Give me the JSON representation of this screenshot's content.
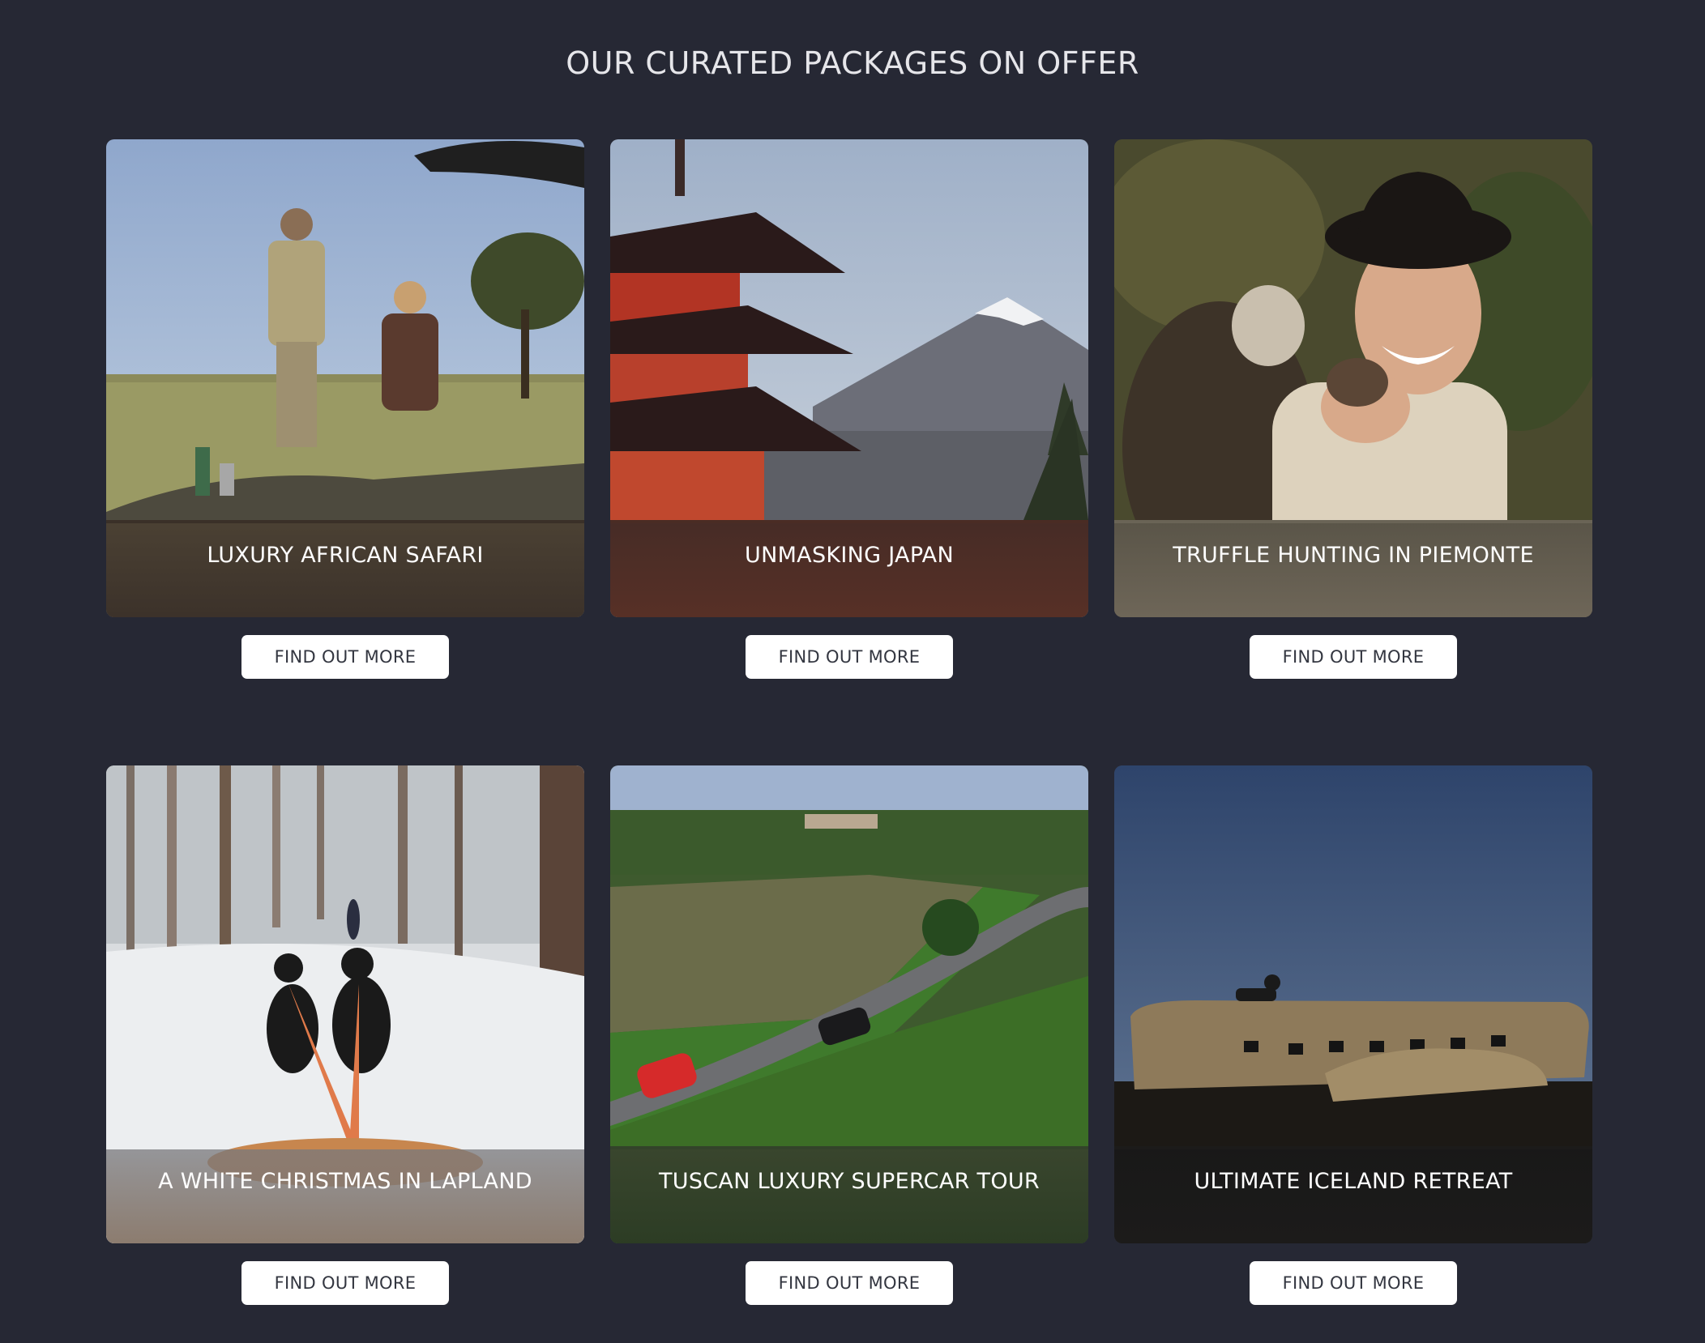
{
  "section": {
    "title": "OUR CURATED PACKAGES ON OFFER"
  },
  "packages": [
    {
      "title": "LUXURY AFRICAN SAFARI",
      "button_label": "FIND OUT MORE"
    },
    {
      "title": "UNMASKING JAPAN",
      "button_label": "FIND OUT MORE"
    },
    {
      "title": "TRUFFLE HUNTING IN PIEMONTE",
      "button_label": "FIND OUT MORE"
    },
    {
      "title": "A WHITE CHRISTMAS IN LAPLAND",
      "button_label": "FIND OUT MORE"
    },
    {
      "title": "TUSCAN LUXURY SUPERCAR TOUR",
      "button_label": "FIND OUT MORE"
    },
    {
      "title": "ULTIMATE ICELAND RETREAT",
      "button_label": "FIND OUT MORE"
    }
  ],
  "colors": {
    "background": "#262834",
    "button_bg": "#ffffff",
    "button_text": "#333640"
  }
}
